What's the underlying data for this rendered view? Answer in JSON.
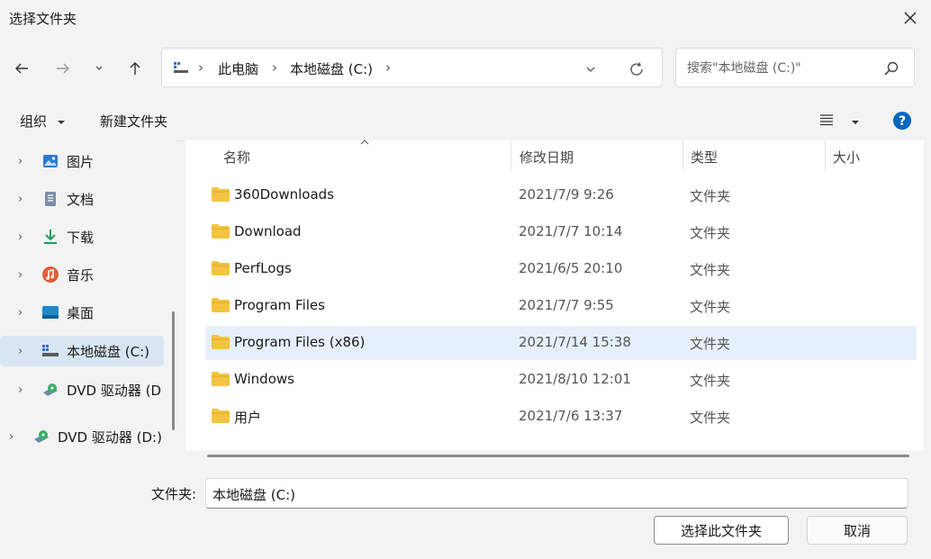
{
  "window": {
    "title": "选择文件夹"
  },
  "address_bar": {
    "crumbs": [
      "此电脑",
      "本地磁盘 (C:)"
    ]
  },
  "search": {
    "placeholder": "搜索\"本地磁盘 (C:)\""
  },
  "toolbar": {
    "organize_label": "组织",
    "new_folder_label": "新建文件夹"
  },
  "sidebar": {
    "items": [
      {
        "label": "图片",
        "icon": "pictures-icon"
      },
      {
        "label": "文档",
        "icon": "documents-icon"
      },
      {
        "label": "下载",
        "icon": "download-icon"
      },
      {
        "label": "音乐",
        "icon": "music-icon"
      },
      {
        "label": "桌面",
        "icon": "desktop-icon"
      },
      {
        "label": "本地磁盘 (C:)",
        "icon": "drive-icon",
        "selected": true
      },
      {
        "label": "DVD 驱动器 (D",
        "icon": "dvd-icon"
      },
      {
        "label": "DVD 驱动器 (D:)",
        "icon": "dvd-icon"
      }
    ]
  },
  "columns": {
    "name": "名称",
    "modified": "修改日期",
    "type": "类型",
    "size": "大小"
  },
  "files": [
    {
      "name": "360Downloads",
      "modified": "2021/7/9 9:26",
      "type": "文件夹"
    },
    {
      "name": "Download",
      "modified": "2021/7/7 10:14",
      "type": "文件夹"
    },
    {
      "name": "PerfLogs",
      "modified": "2021/6/5 20:10",
      "type": "文件夹"
    },
    {
      "name": "Program Files",
      "modified": "2021/7/7 9:55",
      "type": "文件夹"
    },
    {
      "name": "Program Files (x86)",
      "modified": "2021/7/14 15:38",
      "type": "文件夹"
    },
    {
      "name": "Windows",
      "modified": "2021/8/10 12:01",
      "type": "文件夹"
    },
    {
      "name": "用户",
      "modified": "2021/7/6 13:37",
      "type": "文件夹"
    }
  ],
  "footer": {
    "folder_label": "文件夹:",
    "folder_value": "本地磁盘 (C:)",
    "select_button": "选择此文件夹",
    "cancel_button": "取消"
  },
  "colors": {
    "accent": "#0067c0",
    "folder": "#f3c440",
    "selection": "#d8e6f3"
  }
}
